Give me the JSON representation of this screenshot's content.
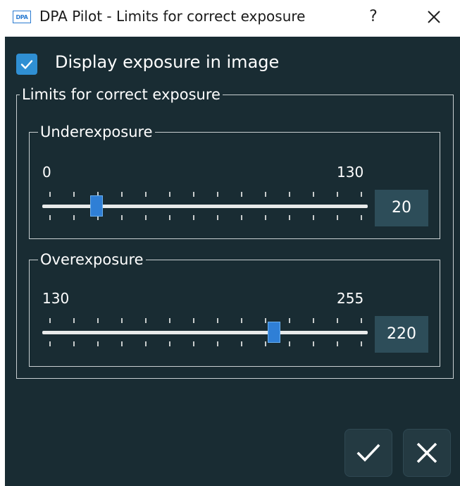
{
  "window": {
    "icon_text": "DPA",
    "title": "DPA Pilot - Limits for correct exposure",
    "help_label": "?"
  },
  "display_exposure": {
    "label": "Display exposure in image",
    "checked": true
  },
  "limits_group": {
    "title": "Limits for correct exposure",
    "underexposure": {
      "title": "Underexposure",
      "min": 0,
      "max": 130,
      "value": 20,
      "min_label": "0",
      "max_label": "130",
      "value_label": "20"
    },
    "overexposure": {
      "title": "Overexposure",
      "min": 130,
      "max": 255,
      "value": 220,
      "min_label": "130",
      "max_label": "255",
      "value_label": "220"
    }
  },
  "actions": {
    "ok_icon": "checkmark-icon",
    "cancel_icon": "x-icon"
  },
  "colors": {
    "background": "#192c33",
    "accent": "#2f8fd3",
    "value_box": "#2d4d59"
  }
}
